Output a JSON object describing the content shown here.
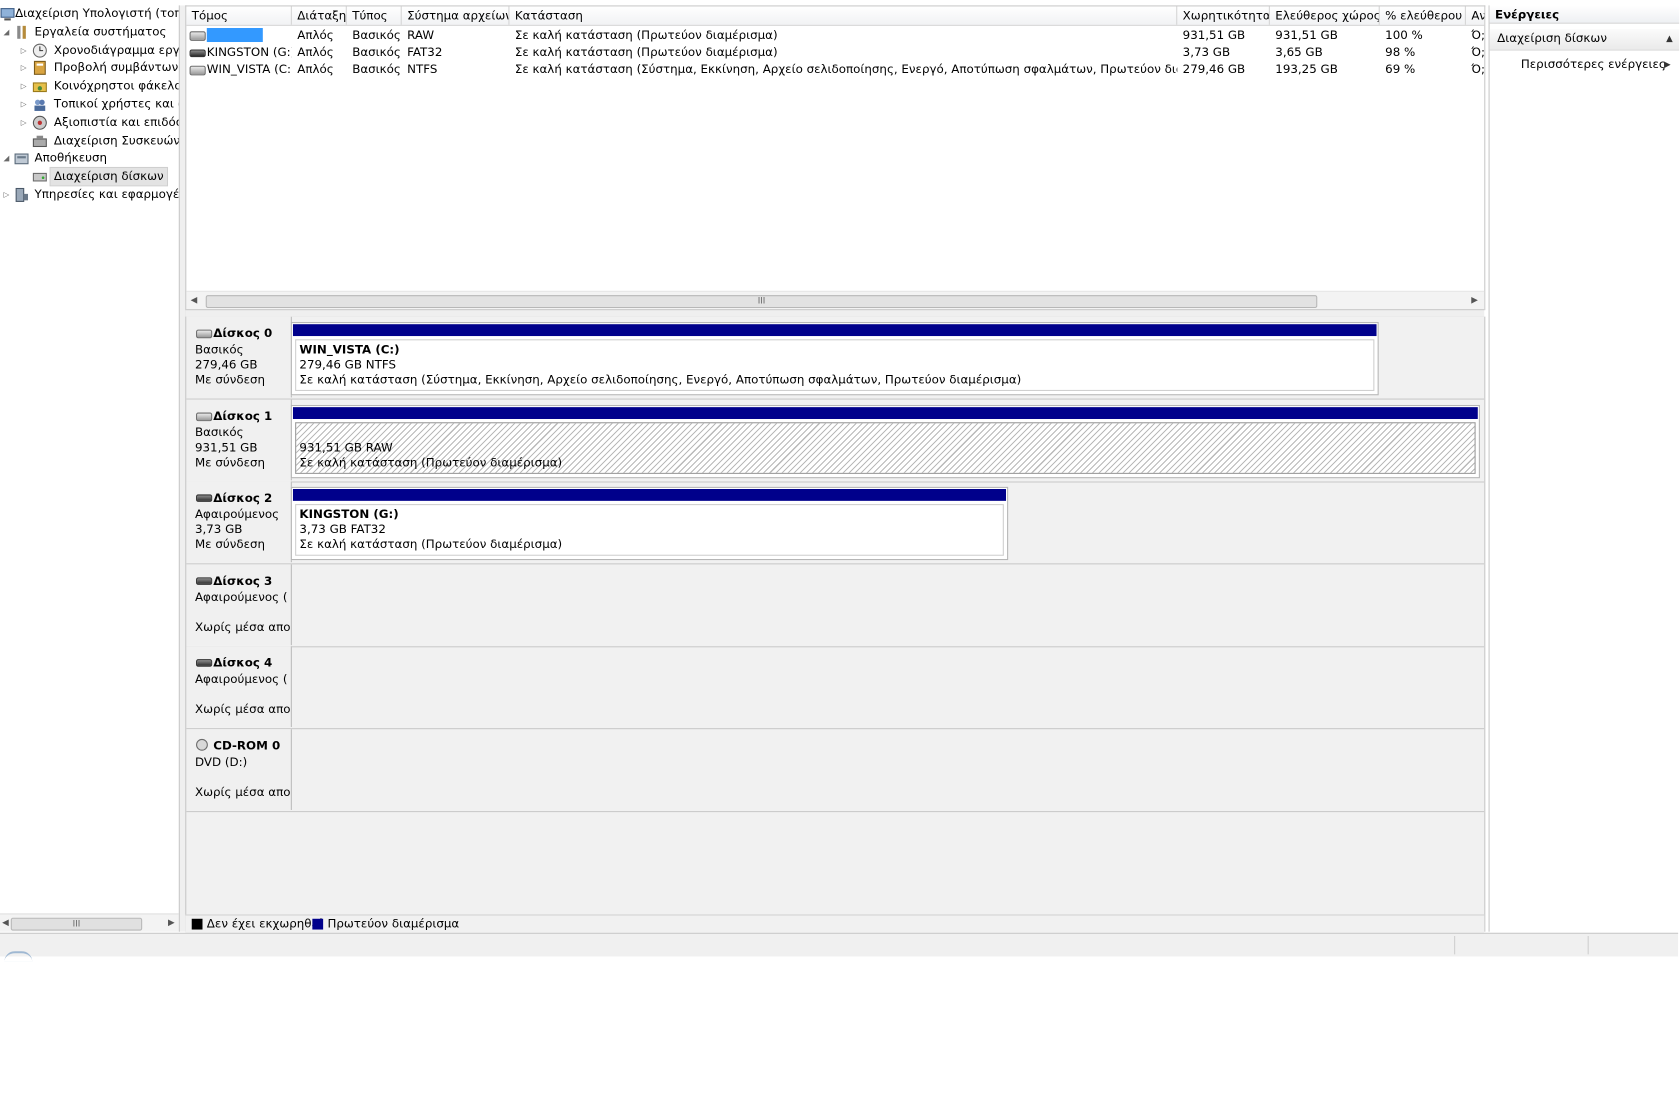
{
  "tree": {
    "items": [
      {
        "label": "Διαχείριση Υπολογιστή (τοπικά)",
        "icon": "computer-icon",
        "level": 0,
        "expand": "none"
      },
      {
        "label": "Εργαλεία συστήματος",
        "icon": "tools-icon",
        "level": 1,
        "expand": "expanded"
      },
      {
        "label": "Χρονοδιάγραμμα εργασιών",
        "icon": "clock-icon",
        "level": 2,
        "expand": "collapsed"
      },
      {
        "label": "Προβολή συμβάντων",
        "icon": "event-viewer-icon",
        "level": 2,
        "expand": "collapsed"
      },
      {
        "label": "Κοινόχρηστοι φάκελοι",
        "icon": "shared-folder-icon",
        "level": 2,
        "expand": "collapsed"
      },
      {
        "label": "Τοπικοί χρήστες και ομάδες",
        "icon": "users-icon",
        "level": 2,
        "expand": "collapsed"
      },
      {
        "label": "Αξιοπιστία και επιδόσεις",
        "icon": "performance-icon",
        "level": 2,
        "expand": "collapsed"
      },
      {
        "label": "Διαχείριση Συσκευών",
        "icon": "device-manager-icon",
        "level": 2,
        "expand": "none"
      },
      {
        "label": "Αποθήκευση",
        "icon": "storage-icon",
        "level": 1,
        "expand": "expanded"
      },
      {
        "label": "Διαχείριση δίσκων",
        "icon": "disk-management-icon",
        "level": 2,
        "expand": "none",
        "selected": true
      },
      {
        "label": "Υπηρεσίες και εφαρμογές",
        "icon": "services-icon",
        "level": 1,
        "expand": "collapsed"
      }
    ]
  },
  "volumes": {
    "columns": [
      "Τόμος",
      "Διάταξη",
      "Τύπος",
      "Σύστημα αρχείων",
      "Κατάσταση",
      "Χωρητικότητα",
      "Ελεύθερος χώρος",
      "% ελεύθερου",
      "Αν"
    ],
    "rows": [
      {
        "name": "",
        "layout": "Απλός",
        "type": "Βασικός",
        "fs": "RAW",
        "status": "Σε καλή κατάσταση (Πρωτεύον διαμέρισμα)",
        "capacity": "931,51 GB",
        "free": "931,51 GB",
        "pct": "100 %",
        "fault": "Ό;"
      },
      {
        "name": "KINGSTON (G:)",
        "layout": "Απλός",
        "type": "Βασικός",
        "fs": "FAT32",
        "status": "Σε καλή κατάσταση (Πρωτεύον διαμέρισμα)",
        "capacity": "3,73 GB",
        "free": "3,65 GB",
        "pct": "98 %",
        "fault": "Ό;"
      },
      {
        "name": "WIN_VISTA (C:)",
        "layout": "Απλός",
        "type": "Βασικός",
        "fs": "NTFS",
        "status": "Σε καλή κατάσταση (Σύστημα, Εκκίνηση, Αρχείο σελιδοποίησης, Ενεργό, Αποτύπωση σφαλμάτων, Πρωτεύον διαμέρισμα)",
        "capacity": "279,46 GB",
        "free": "193,25 GB",
        "pct": "69 %",
        "fault": "Ό;"
      }
    ]
  },
  "disks": [
    {
      "name": "Δίσκος 0",
      "type": "Βασικός",
      "size": "279,46 GB",
      "state": "Με σύνδεση",
      "icon": "hard-disk-icon",
      "partition": {
        "label": "WIN_VISTA  (C:)",
        "detail": "279,46 GB NTFS",
        "status": "Σε καλή κατάσταση (Σύστημα, Εκκίνηση, Αρχείο σελιδοποίησης, Ενεργό, Αποτύπωση σφαλμάτων, Πρωτεύον διαμέρισμα)",
        "share": 0.915,
        "hatched": false
      }
    },
    {
      "name": "Δίσκος 1",
      "type": "Βασικός",
      "size": "931,51 GB",
      "state": "Με σύνδεση",
      "icon": "hard-disk-icon",
      "partition": {
        "label": "",
        "detail": "931,51 GB RAW",
        "status": "Σε καλή κατάσταση (Πρωτεύον διαμέρισμα)",
        "share": 1.0,
        "hatched": true
      }
    },
    {
      "name": "Δίσκος 2",
      "type": "Αφαιρούμενος",
      "size": "3,73 GB",
      "state": "Με σύνδεση",
      "icon": "removable-disk-icon",
      "partition": {
        "label": "KINGSTON  (G:)",
        "detail": "3,73 GB FAT32",
        "status": "Σε καλή κατάσταση (Πρωτεύον διαμέρισμα)",
        "share": 0.603,
        "hatched": false
      }
    },
    {
      "name": "Δίσκος 3",
      "type": "Αφαιρούμενος (",
      "size": "",
      "state": "Χωρίς μέσα απο",
      "icon": "removable-disk-icon",
      "partition": null
    },
    {
      "name": "Δίσκος 4",
      "type": "Αφαιρούμενος (",
      "size": "",
      "state": "Χωρίς μέσα απο",
      "icon": "removable-disk-icon",
      "partition": null
    },
    {
      "name": "CD-ROM 0",
      "type": "DVD (D:)",
      "size": "",
      "state": "Χωρίς μέσα απο",
      "icon": "cdrom-icon",
      "partition": null
    }
  ],
  "legend": [
    {
      "label": "Δεν έχει εκχωρηθεί",
      "color": "#000000"
    },
    {
      "label": "Πρωτεύον διαμέρισμα",
      "color": "#00008b"
    }
  ],
  "actions": {
    "title": "Ενέργειες",
    "section": "Διαχείριση δίσκων",
    "more": "Περισσότερες ενέργειες"
  },
  "scroll_thumb": "III"
}
